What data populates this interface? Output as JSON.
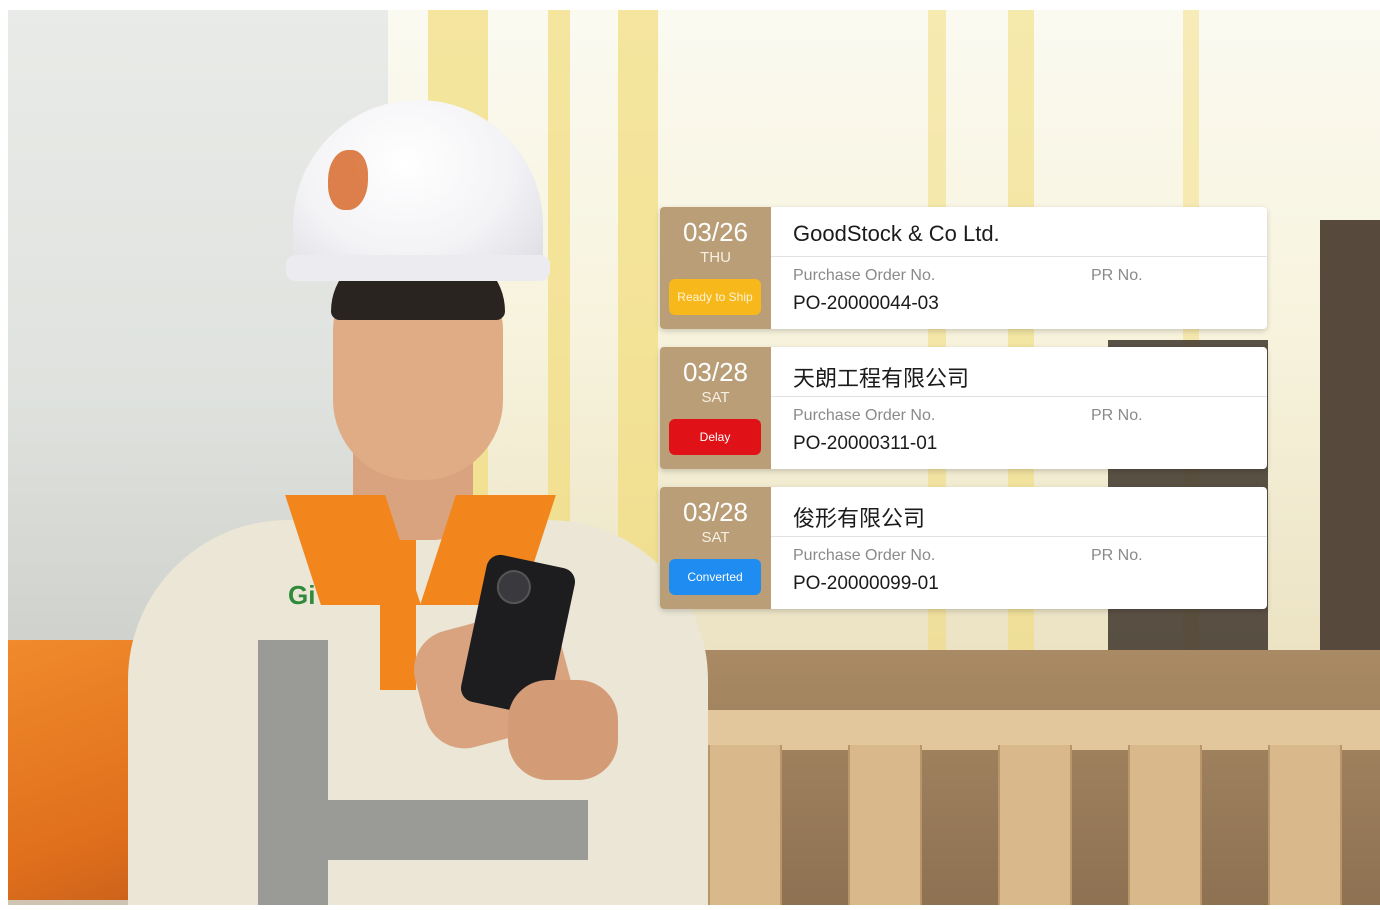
{
  "orders": [
    {
      "date": "03/26",
      "weekday": "THU",
      "status": "Ready to Ship",
      "status_color": "#f6b81a",
      "company": "GoodStock & Co Ltd.",
      "po_label": "Purchase Order No.",
      "pr_label": "PR No.",
      "po_number": "PO-20000044-03"
    },
    {
      "date": "03/28",
      "weekday": "SAT",
      "status": "Delay",
      "status_color": "#e11217",
      "company": "天朗工程有限公司",
      "po_label": "Purchase Order No.",
      "pr_label": "PR No.",
      "po_number": "PO-20000311-01"
    },
    {
      "date": "03/28",
      "weekday": "SAT",
      "status": "Converted",
      "status_color": "#1e8cf0",
      "company": "俊形有限公司",
      "po_label": "Purchase Order No.",
      "pr_label": "PR No.",
      "po_number": "PO-20000099-01"
    }
  ],
  "colors": {
    "date_panel": "#b99e77"
  }
}
